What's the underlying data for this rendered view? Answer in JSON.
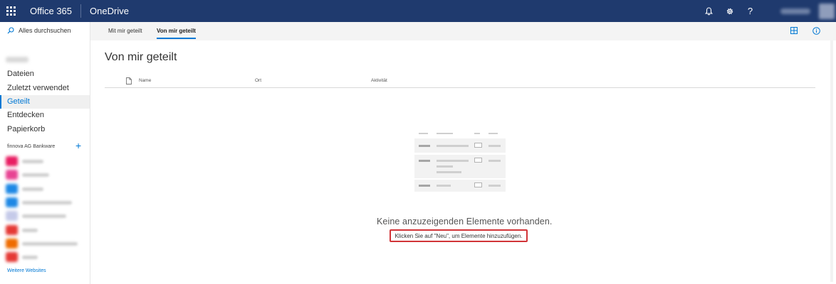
{
  "topbar": {
    "brand": "Office 365",
    "app_name": "OneDrive",
    "icons": [
      "waffle-icon",
      "bell-icon",
      "gear-icon",
      "help-icon"
    ],
    "help_glyph": "?",
    "color": "#1f3a6e"
  },
  "sidebar": {
    "search_label": "Alles durchsuchen",
    "items": [
      {
        "label": "Dateien"
      },
      {
        "label": "Zuletzt verwendet"
      },
      {
        "label": "Geteilt"
      },
      {
        "label": "Entdecken"
      },
      {
        "label": "Papierkorb"
      }
    ],
    "active_item": "Geteilt",
    "section_title": "finnova AG Bankware",
    "add_glyph": "+",
    "sites_colors": [
      "#e91e63",
      "#e84393",
      "#1e88e5",
      "#1e88e5",
      "#c5cae9",
      "#e53935",
      "#ef6c00",
      "#e53935"
    ],
    "more_sites": "Weitere Websites",
    "accent": "#0078d4"
  },
  "tabs": [
    {
      "label": "Mit mir geteilt"
    },
    {
      "label": "Von mir geteilt"
    }
  ],
  "active_tab": "Von mir geteilt",
  "main": {
    "title": "Von mir geteilt",
    "columns": {
      "name": "Name",
      "location": "Ort",
      "activity": "Aktivität"
    },
    "empty_title": "Keine anzuzeigenden Elemente vorhanden.",
    "empty_subtitle": "Klicken Sie auf \"Neu\", um Elemente hinzuzufügen.",
    "highlight_color": "#d13438"
  }
}
